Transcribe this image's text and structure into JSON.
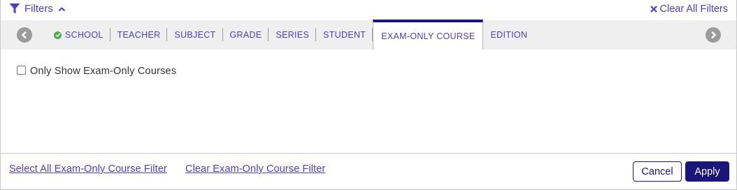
{
  "header": {
    "filters_label": "Filters",
    "clear_all_label": "Clear All Filters"
  },
  "tabs": [
    {
      "label": "SCHOOL",
      "checked": true,
      "active": false
    },
    {
      "label": "TEACHER",
      "checked": false,
      "active": false
    },
    {
      "label": "SUBJECT",
      "checked": false,
      "active": false
    },
    {
      "label": "GRADE",
      "checked": false,
      "active": false
    },
    {
      "label": "SERIES",
      "checked": false,
      "active": false
    },
    {
      "label": "STUDENT",
      "checked": false,
      "active": false
    },
    {
      "label": "EXAM-ONLY COURSE",
      "checked": false,
      "active": true
    },
    {
      "label": "EDITION",
      "checked": false,
      "active": false
    }
  ],
  "body": {
    "checkbox_label": "Only Show Exam-Only Courses",
    "checkbox_checked": false
  },
  "footer": {
    "select_all_link": "Select All Exam-Only Course Filter",
    "clear_link": "Clear Exam-Only Course Filter",
    "cancel_label": "Cancel",
    "apply_label": "Apply"
  },
  "colors": {
    "accent": "#4b3ec4",
    "primary": "#1a157a",
    "success": "#4caf50",
    "tabbar_bg": "#efefef"
  },
  "icons": {
    "filter": "funnel-icon",
    "collapse": "chevron-up-icon",
    "clear": "close-icon",
    "prev": "chevron-left-icon",
    "next": "chevron-right-icon",
    "check": "check-circle-icon"
  }
}
